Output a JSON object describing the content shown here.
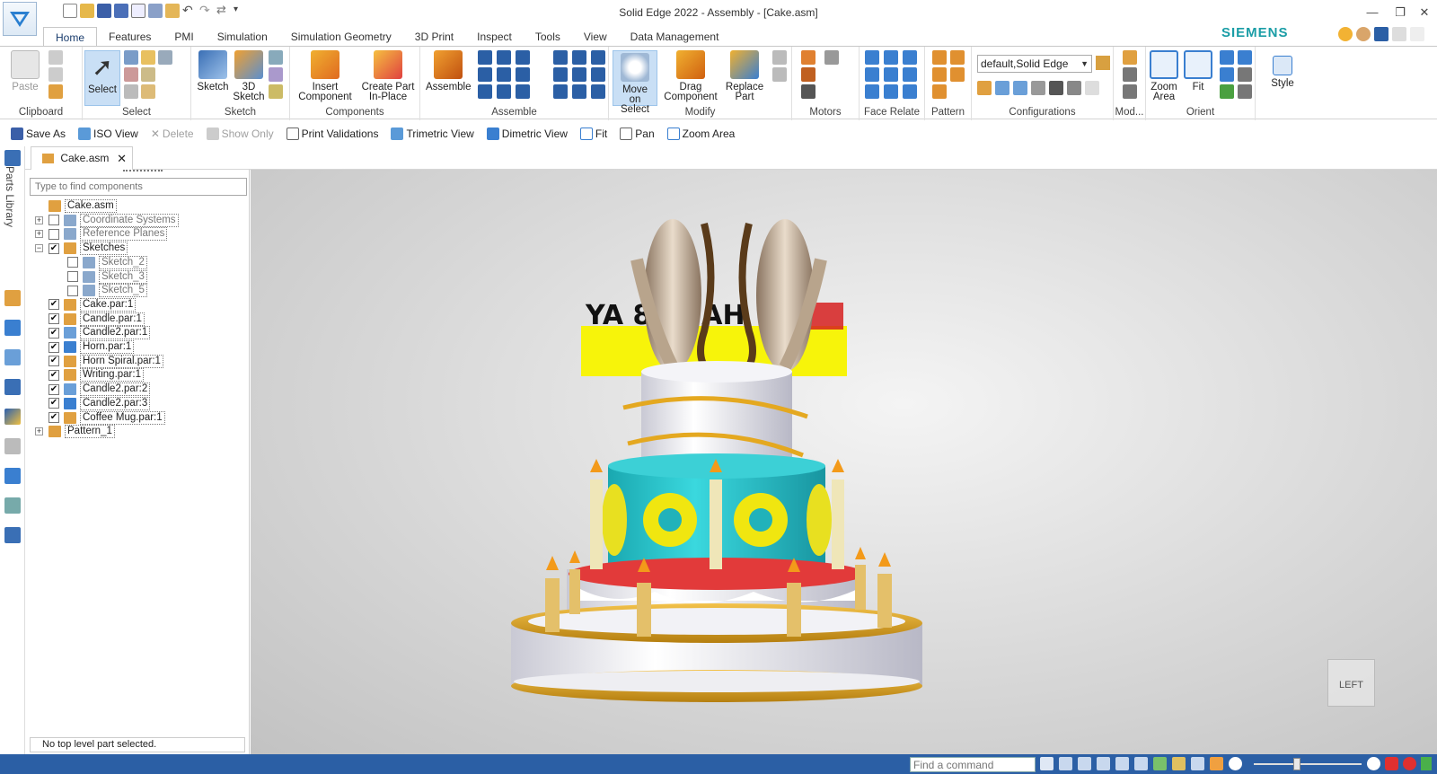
{
  "window": {
    "title": "Solid Edge 2022 - Assembly - [Cake.asm]"
  },
  "brand": "SIEMENS",
  "ribbon_tabs": [
    "Home",
    "Features",
    "PMI",
    "Simulation",
    "Simulation Geometry",
    "3D Print",
    "Inspect",
    "Tools",
    "View",
    "Data Management"
  ],
  "ribbon": {
    "clipboard": {
      "label": "Clipboard",
      "paste": "Paste"
    },
    "select": {
      "label": "Select",
      "select": "Select"
    },
    "sketch": {
      "label": "Sketch",
      "sketch": "Sketch",
      "sketch3d_1": "3D",
      "sketch3d_2": "Sketch"
    },
    "components": {
      "label": "Components",
      "insert_1": "Insert",
      "insert_2": "Component",
      "create_1": "Create Part",
      "create_2": "In-Place"
    },
    "assemble": {
      "label": "Assemble",
      "assemble": "Assemble"
    },
    "modify": {
      "label": "Modify",
      "move_1": "Move on",
      "move_2": "Select",
      "drag_1": "Drag",
      "drag_2": "Component",
      "replace_1": "Replace",
      "replace_2": "Part"
    },
    "motors": {
      "label": "Motors"
    },
    "face_relate": {
      "label": "Face Relate"
    },
    "pattern": {
      "label": "Pattern"
    },
    "configurations": {
      "label": "Configurations",
      "combo": "default,Solid Edge"
    },
    "mod": {
      "label": "Mod..."
    },
    "orient": {
      "label": "Orient",
      "zoom_1": "Zoom",
      "zoom_2": "Area",
      "fit": "Fit"
    },
    "style": {
      "style": "Style"
    }
  },
  "command_bar": [
    "Save As",
    "ISO View",
    "Delete",
    "Show Only",
    "Print Validations",
    "Trimetric View",
    "Dimetric View",
    "Fit",
    "Pan",
    "Zoom Area"
  ],
  "doc_tab": "Cake.asm",
  "parts_library": "Parts Library",
  "search": {
    "placeholder": "Type to find components"
  },
  "tree": [
    {
      "label": "Cake.asm",
      "indent": 0,
      "checked": null,
      "expand": null
    },
    {
      "label": "Coordinate Systems",
      "indent": 1,
      "checked": false,
      "expand": "+",
      "grey": true
    },
    {
      "label": "Reference Planes",
      "indent": 1,
      "checked": false,
      "expand": "+",
      "grey": true
    },
    {
      "label": "Sketches",
      "indent": 1,
      "checked": true,
      "expand": "−"
    },
    {
      "label": "Sketch_2",
      "indent": 2,
      "checked": false,
      "expand": null,
      "grey": true
    },
    {
      "label": "Sketch_3",
      "indent": 2,
      "checked": false,
      "expand": null,
      "grey": true
    },
    {
      "label": "Sketch_5",
      "indent": 2,
      "checked": false,
      "expand": null,
      "grey": true
    },
    {
      "label": "Cake.par:1",
      "indent": 1,
      "checked": true,
      "expand": null
    },
    {
      "label": "Candle.par:1",
      "indent": 1,
      "checked": true,
      "expand": null
    },
    {
      "label": "Candle2.par:1",
      "indent": 1,
      "checked": true,
      "expand": null
    },
    {
      "label": "Horn.par:1",
      "indent": 1,
      "checked": true,
      "expand": null
    },
    {
      "label": "Horn Spiral.par:1",
      "indent": 1,
      "checked": true,
      "expand": null
    },
    {
      "label": "Writing.par:1",
      "indent": 1,
      "checked": true,
      "expand": null
    },
    {
      "label": "Candle2.par:2",
      "indent": 1,
      "checked": true,
      "expand": null
    },
    {
      "label": "Candle2.par:3",
      "indent": 1,
      "checked": true,
      "expand": null
    },
    {
      "label": "Coffee Mug.par:1",
      "indent": 1,
      "checked": true,
      "expand": null
    },
    {
      "label": "Pattern_1",
      "indent": 0,
      "checked": null,
      "expand": "+"
    }
  ],
  "status": "No top level part selected.",
  "viewport": {
    "writing": "YA   8IRI   AH",
    "view_label": "LEFT"
  },
  "find_command": {
    "placeholder": "Find a command"
  }
}
